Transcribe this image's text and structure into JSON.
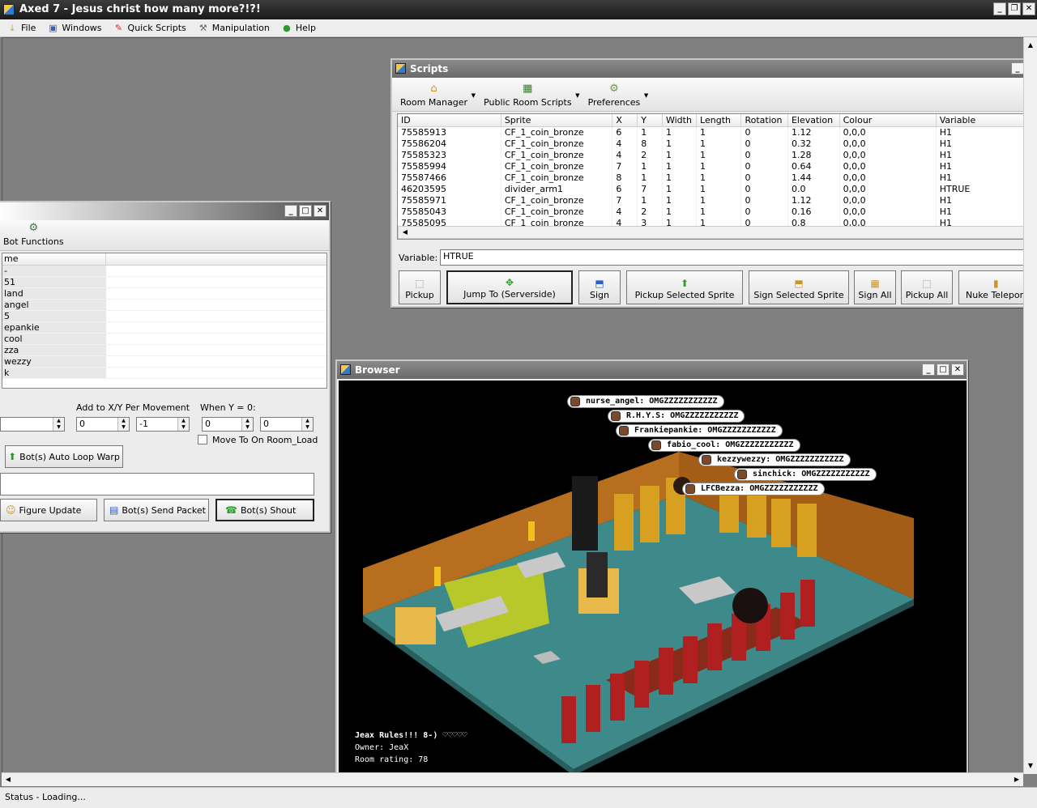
{
  "app": {
    "title": "Axed 7 - Jesus christ how many more?!?!"
  },
  "menu": [
    {
      "label": "File",
      "icon": "download-icon"
    },
    {
      "label": "Windows",
      "icon": "monitor-icon"
    },
    {
      "label": "Quick Scripts",
      "icon": "pen-icon"
    },
    {
      "label": "Manipulation",
      "icon": "tools-icon"
    },
    {
      "label": "Help",
      "icon": "help-icon"
    }
  ],
  "scripts": {
    "title": "Scripts",
    "toolbar": {
      "room_manager": "Room Manager",
      "public_room_scripts": "Public Room Scripts",
      "preferences": "Preferences"
    },
    "columns": [
      "ID",
      "Sprite",
      "X",
      "Y",
      "Width",
      "Length",
      "Rotation",
      "Elevation",
      "Colour",
      "Variable"
    ],
    "rows": [
      [
        "75585913",
        "CF_1_coin_bronze",
        "6",
        "1",
        "1",
        "1",
        "0",
        "1.12",
        "0,0,0",
        "H1"
      ],
      [
        "75586204",
        "CF_1_coin_bronze",
        "4",
        "8",
        "1",
        "1",
        "0",
        "0.32",
        "0,0,0",
        "H1"
      ],
      [
        "75585323",
        "CF_1_coin_bronze",
        "4",
        "2",
        "1",
        "1",
        "0",
        "1.28",
        "0,0,0",
        "H1"
      ],
      [
        "75585994",
        "CF_1_coin_bronze",
        "7",
        "1",
        "1",
        "1",
        "0",
        "0.64",
        "0,0,0",
        "H1"
      ],
      [
        "75587466",
        "CF_1_coin_bronze",
        "8",
        "1",
        "1",
        "1",
        "0",
        "1.44",
        "0,0,0",
        "H1"
      ],
      [
        "46203595",
        "divider_arm1",
        "6",
        "7",
        "1",
        "1",
        "0",
        "0.0",
        "0,0,0",
        "HTRUE"
      ],
      [
        "75585971",
        "CF_1_coin_bronze",
        "7",
        "1",
        "1",
        "1",
        "0",
        "1.12",
        "0,0,0",
        "H1"
      ],
      [
        "75585043",
        "CF_1_coin_bronze",
        "4",
        "2",
        "1",
        "1",
        "0",
        "0.16",
        "0,0,0",
        "H1"
      ],
      [
        "75585095",
        "CF_1_coin_bronze",
        "4",
        "3",
        "1",
        "1",
        "0",
        "0.8",
        "0,0,0",
        "H1"
      ]
    ],
    "variable_label": "Variable:",
    "variable_value": "HTRUE",
    "buttons": {
      "pickup": "Pickup",
      "jump_to": "Jump To (Serverside)",
      "sign": "Sign",
      "pickup_selected": "Pickup Selected Sprite",
      "sign_selected": "Sign Selected Sprite",
      "sign_all": "Sign All",
      "pickup_all": "Pickup All",
      "nuke_teleport": "Nuke Teleport"
    }
  },
  "bots": {
    "toolbar": {
      "bot_functions": "Bot Functions"
    },
    "column": "me",
    "names": [
      "-",
      "51",
      "land",
      "angel",
      "5",
      "epankie",
      "cool",
      "zza",
      "wezzy",
      "k"
    ],
    "labels": {
      "add_xy": "Add to X/Y Per Movement",
      "when_y": "When Y = 0:",
      "move_to": "Move To On Room_Load"
    },
    "spins": {
      "first": "",
      "add_x": "0",
      "add_y": "-1",
      "when_a": "0",
      "when_b": "0"
    },
    "buttons": {
      "auto_loop": "Bot(s) Auto Loop Warp",
      "figure_update": "Figure Update",
      "send_packet": "Bot(s) Send Packet",
      "shout": "Bot(s) Shout"
    }
  },
  "browser": {
    "title": "Browser",
    "bubbles": [
      "nurse_angel: OMGZZZZZZZZZZZ",
      "R.H.Y.S: OMGZZZZZZZZZZZ",
      "Frankiepankie: OMGZZZZZZZZZZZ",
      "fabio_cool: OMGZZZZZZZZZZZ",
      "kezzywezzy: OMGZZZZZZZZZZZ",
      "sinchick: OMGZZZZZZZZZZZ",
      "LFCBezza: OMGZZZZZZZZZZZ"
    ],
    "room": {
      "name": "Jeax Rules!!! 8-) ♡♡♡♡♡",
      "owner": "Owner: JeaX",
      "rating": "Room rating: 78"
    }
  },
  "status": {
    "text": "Status -   Loading..."
  }
}
